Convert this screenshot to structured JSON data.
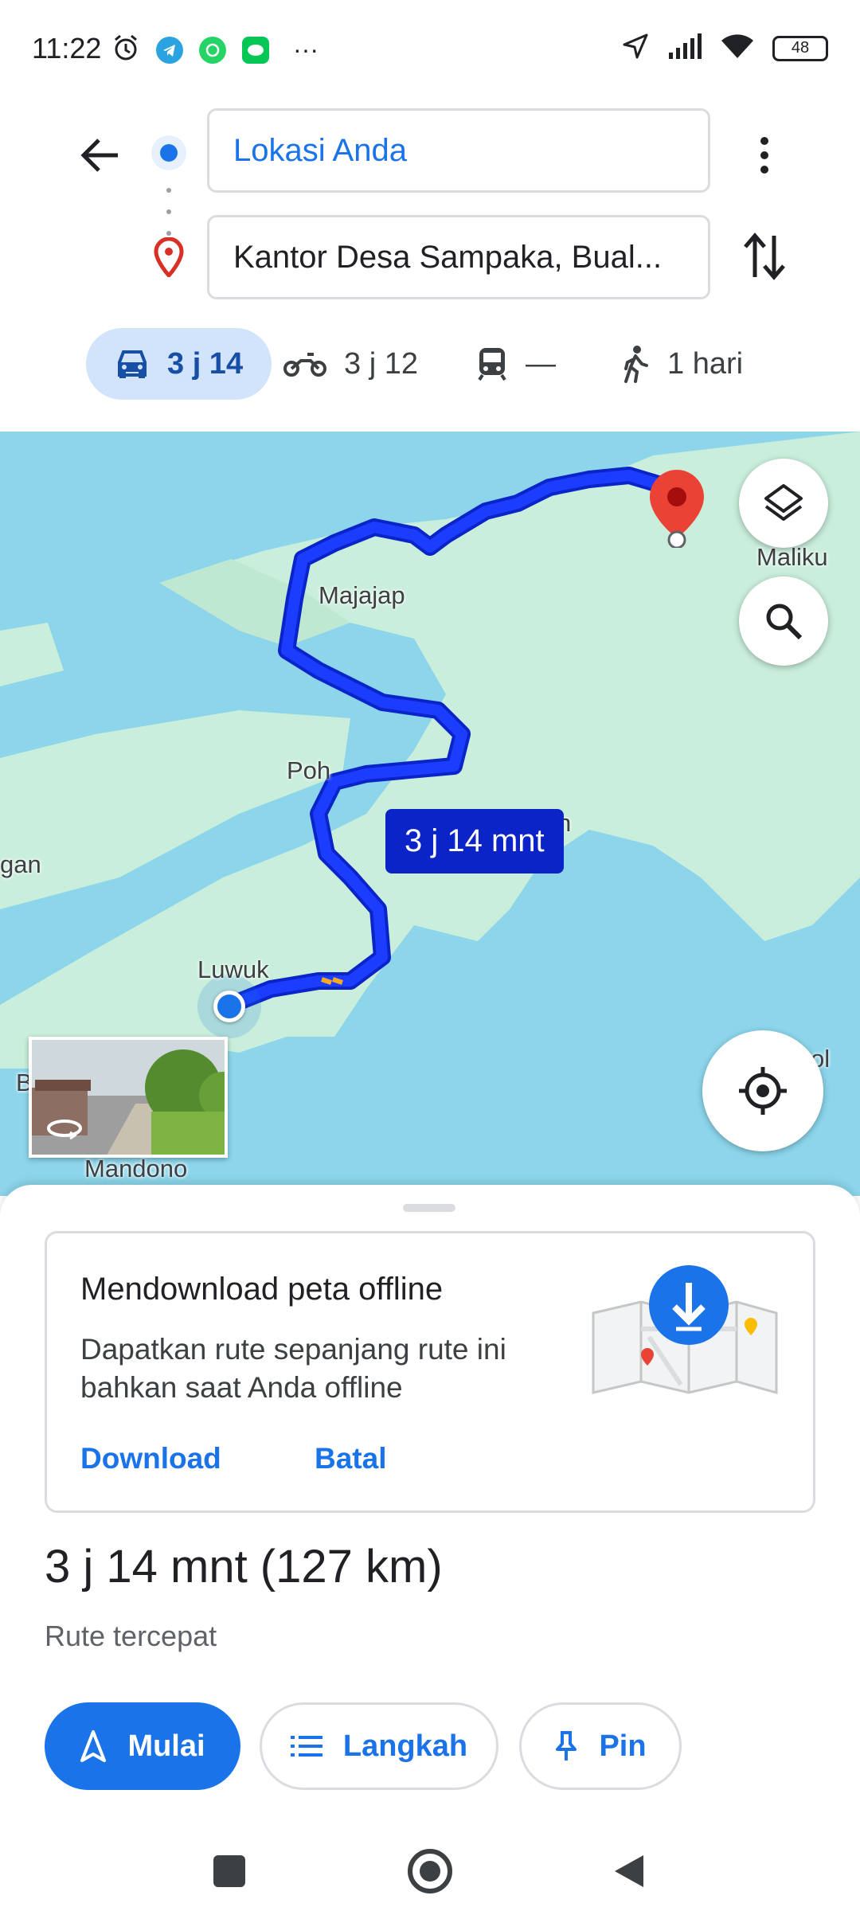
{
  "status_bar": {
    "time": "11:22",
    "battery": "48",
    "more": "···"
  },
  "directions": {
    "origin": "Lokasi Anda",
    "destination": "Kantor Desa Sampaka, Bual..."
  },
  "modes": [
    {
      "icon": "car-icon",
      "label": "3 j 14",
      "active": true
    },
    {
      "icon": "motorcycle-icon",
      "label": "3 j 12",
      "active": false
    },
    {
      "icon": "transit-icon",
      "label": "—",
      "active": false
    },
    {
      "icon": "walk-icon",
      "label": "1 hari",
      "active": false
    }
  ],
  "map": {
    "labels": {
      "maliku": "Maliku",
      "majajap": "Majajap",
      "poh": "Poh",
      "gan": "gan",
      "luwuk": "Luwuk",
      "mandono": "Mandono",
      "b": "B",
      "ol": "ol",
      "n": "n"
    },
    "route_time": "3 j 14 mnt",
    "route_color": "#1a3dff"
  },
  "offline_card": {
    "title": "Mendownload peta offline",
    "description": "Dapatkan rute sepanjang rute ini bahkan saat Anda offline",
    "download": "Download",
    "cancel": "Batal"
  },
  "route_summary": {
    "duration": "3 j 14 mnt (127 km)",
    "subtitle": "Rute tercepat"
  },
  "actions": {
    "start": "Mulai",
    "steps": "Langkah",
    "pin": "Pin"
  },
  "colors": {
    "accent": "#1a73e8",
    "active_mode_bg": "#d2e3fc",
    "water": "#8cd5ea",
    "land": "#c9eedb",
    "pin_red": "#ea4335"
  }
}
